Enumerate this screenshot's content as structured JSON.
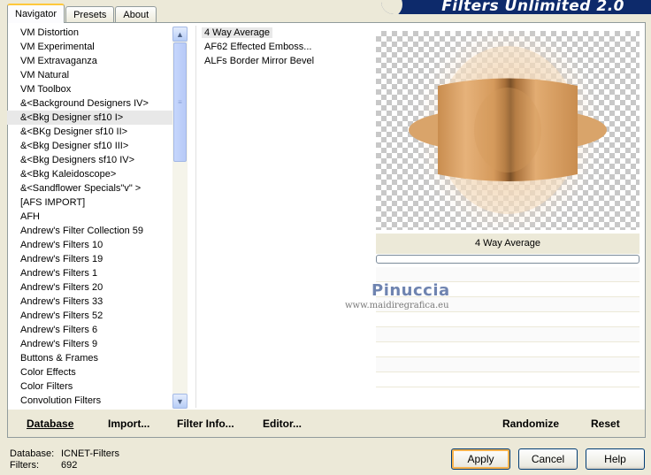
{
  "tabs": [
    "Navigator",
    "Presets",
    "About"
  ],
  "banner_title": "Filters Unlimited 2.0",
  "categories": [
    "VM Distortion",
    "VM Experimental",
    "VM Extravaganza",
    "VM Natural",
    "VM Toolbox",
    "&<Background Designers IV>",
    "&<Bkg Designer sf10 I>",
    "&<BKg Designer sf10 II>",
    "&<Bkg Designer sf10 III>",
    "&<Bkg Designers sf10 IV>",
    "&<Bkg Kaleidoscope>",
    "&<Sandflower Specials\"v\" >",
    "[AFS IMPORT]",
    "AFH",
    "Andrew's Filter Collection 59",
    "Andrew's Filters 10",
    "Andrew's Filters 19",
    "Andrew's Filters 1",
    "Andrew's Filters 20",
    "Andrew's Filters 33",
    "Andrew's Filters 52",
    "Andrew's Filters 6",
    "Andrew's Filters 9",
    "Buttons & Frames",
    "Color Effects",
    "Color Filters",
    "Convolution Filters"
  ],
  "filters": [
    "4 Way Average",
    "AF62 Effected Emboss...",
    "ALFs Border Mirror Bevel"
  ],
  "selected_filter_name": "4 Way Average",
  "watermark": {
    "name": "Pinuccia",
    "url": "www.maidiregrafica.eu"
  },
  "toolbar": {
    "database": "Database",
    "import": "Import...",
    "filter_info": "Filter Info...",
    "editor": "Editor...",
    "randomize": "Randomize",
    "reset": "Reset"
  },
  "status": {
    "database_label": "Database:",
    "database_value": "ICNET-Filters",
    "filters_label": "Filters:",
    "filters_value": "692"
  },
  "buttons": {
    "apply": "Apply",
    "cancel": "Cancel",
    "help": "Help"
  },
  "icons": {
    "scroll_up": "chevron-up-icon",
    "scroll_down": "chevron-down-icon"
  },
  "colors": {
    "accent": "#ffc83c",
    "banner": "#0d2a6b",
    "preview_tone": "#d9a46a"
  }
}
